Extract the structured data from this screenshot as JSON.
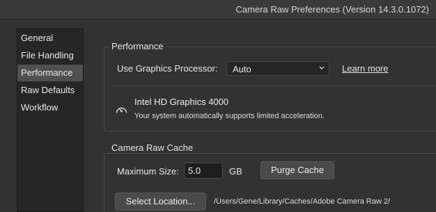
{
  "window": {
    "title": "Camera Raw Preferences  (Version 14.3.0.1072)"
  },
  "sidebar": {
    "items": [
      {
        "label": "General"
      },
      {
        "label": "File Handling"
      },
      {
        "label": "Performance",
        "selected": true
      },
      {
        "label": "Raw Defaults"
      },
      {
        "label": "Workflow"
      }
    ]
  },
  "performance": {
    "group_title": "Performance",
    "gpu_label": "Use Graphics Processor:",
    "gpu_value": "Auto",
    "learn_more": "Learn more",
    "gpu_name": "Intel HD Graphics 4000",
    "gpu_status": "Your system automatically supports limited acceleration.",
    "status_icon": "gauge-icon"
  },
  "cache": {
    "group_title": "Camera Raw Cache",
    "max_size_label": "Maximum Size:",
    "max_size_value": "5.0",
    "unit": "GB",
    "purge_button": "Purge Cache",
    "select_location_button": "Select Location...",
    "location_path": "/Users/Gene/Library/Caches/Adobe Camera Raw 2/"
  },
  "colors": {
    "background": "#323232",
    "sidebar_bg": "#262626",
    "selected_bg": "#505050"
  }
}
